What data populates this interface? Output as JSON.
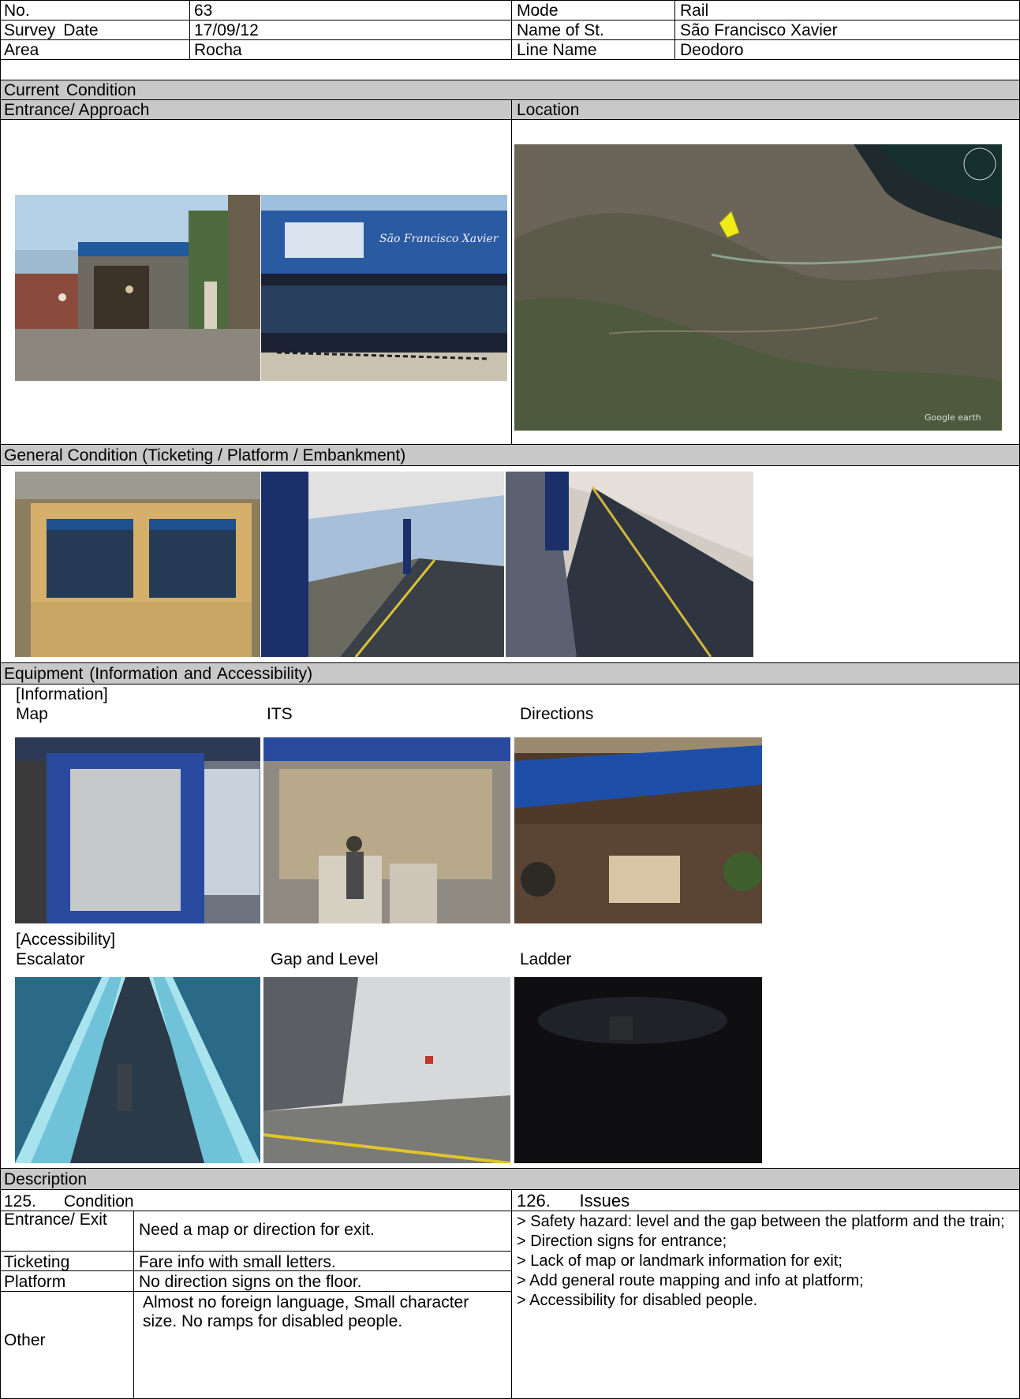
{
  "header": {
    "no_label": "No.",
    "no_value": "63",
    "mode_label": "Mode",
    "mode_value": "Rail",
    "survey_date_label": "Survey Date",
    "survey_date_value": "17/09/12",
    "station_label": "Name of St.",
    "station_value": "São Francisco Xavier",
    "area_label": "Area",
    "area_value": "Rocha",
    "line_label": "Line Name",
    "line_value": "Deodoro"
  },
  "sections": {
    "current_condition": "Current Condition",
    "entrance_approach": "Entrance/ Approach",
    "location": "Location",
    "general_condition": "General Condition (Ticketing / Platform / Embankment)",
    "equipment": "Equipment (Information and Accessibility)",
    "description": "Description"
  },
  "photos": {
    "entrance_sign_text": "São Francisco Xavier"
  },
  "equipment": {
    "information_heading": "[Information]",
    "information_items": [
      "Map",
      "ITS",
      "Directions"
    ],
    "accessibility_heading": "[Accessibility]",
    "accessibility_items": [
      "Escalator",
      "Gap and Level",
      "Ladder"
    ]
  },
  "description": {
    "condition_heading": "125.      Condition",
    "issues_heading": "126.      Issues",
    "rows": [
      {
        "category": "Entrance/ Exit",
        "text": "Need a map or direction for exit."
      },
      {
        "category": "Ticketing",
        "text": "Fare info with small letters."
      },
      {
        "category": "Platform",
        "text": "No direction signs on the floor."
      },
      {
        "category": "Other",
        "text": "Almost no foreign language, Small character size. No ramps for disabled people."
      }
    ],
    "issues": [
      "> Safety hazard: level and the gap between the platform and the train;",
      "> Direction signs for entrance;",
      "> Lack of map or landmark information for exit;",
      "> Add general route mapping and info at platform;",
      "> Accessibility for disabled people."
    ]
  },
  "map": {
    "attribution": "Google earth"
  },
  "colors": {
    "band": "#c8c8c8",
    "border": "#000000",
    "pin": "#f0ec1a"
  }
}
